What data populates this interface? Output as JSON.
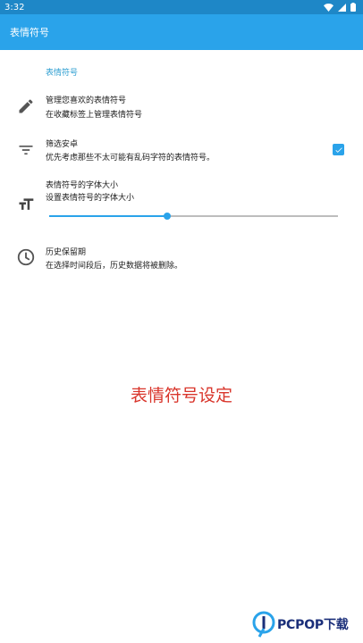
{
  "status_bar": {
    "time": "3:32"
  },
  "app_bar": {
    "title": "表情符号"
  },
  "section": {
    "header": "表情符号"
  },
  "preferences": [
    {
      "icon": "pencil-icon",
      "title": "管理您喜欢的表情符号",
      "summary": "在收藏标签上管理表情符号"
    },
    {
      "icon": "filter-icon",
      "title": "筛选安卓",
      "summary": "优先考虑那些不太可能有乱码字符的表情符号。",
      "checked": true
    },
    {
      "icon": "text-size-icon",
      "title": "表情符号的字体大小",
      "summary": "设置表情符号的字体大小",
      "slider_fraction": 0.41
    },
    {
      "icon": "clock-icon",
      "title": "历史保留期",
      "summary": "在选择时间段后，历史数据将被删除。"
    }
  ],
  "overlay": {
    "caption": "表情符号设定"
  },
  "logo": {
    "text": "PCPOP下载"
  },
  "colors": {
    "status_bar": "#1e87c7",
    "app_bar": "#2aa3ea",
    "accent": "#2aa3ea",
    "section_header": "#2f9fd1",
    "caption": "#d9362c"
  }
}
